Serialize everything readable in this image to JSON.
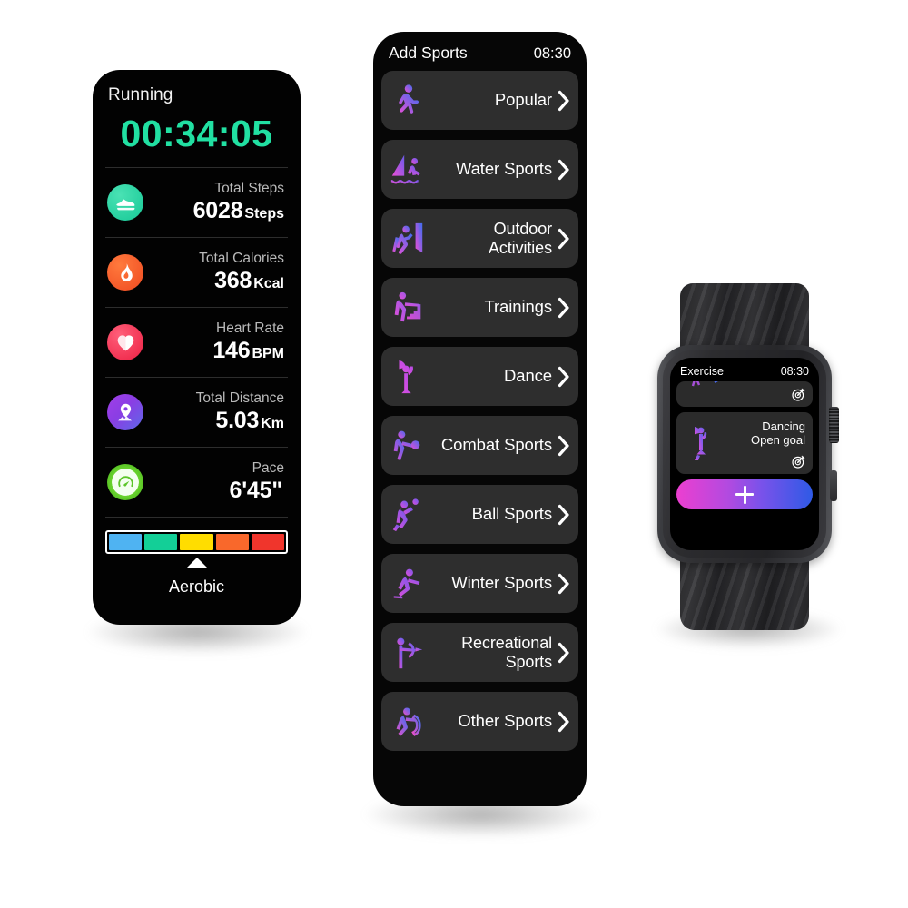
{
  "running_panel": {
    "title": "Running",
    "timer": "00:34:05",
    "timer_color": "#21e0a2",
    "metrics": [
      {
        "icon": "shoe-icon",
        "label": "Total Steps",
        "value": "6028",
        "unit": "Steps",
        "color": "#25d3a0"
      },
      {
        "icon": "flame-icon",
        "label": "Total Calories",
        "value": "368",
        "unit": "Kcal",
        "color": "#f2552a"
      },
      {
        "icon": "heart-icon",
        "label": "Heart Rate",
        "value": "146",
        "unit": "BPM",
        "color": "#f22f4e"
      },
      {
        "icon": "location-icon",
        "label": "Total Distance",
        "value": "5.03",
        "unit": "Km",
        "color": "#8b3fe0"
      },
      {
        "icon": "speedometer-icon",
        "label": "Pace",
        "value": "6'45\"",
        "unit": "",
        "color": "#55c92c"
      }
    ],
    "zone_bar": {
      "segments": [
        "#4fb3f2",
        "#13cf97",
        "#ffdd00",
        "#f9682b",
        "#f0352c"
      ],
      "active_index": 2,
      "zone_name": "Aerobic"
    }
  },
  "sports_panel": {
    "title": "Add Sports",
    "time": "08:30",
    "chevron_icon": "chevron-right-icon",
    "items": [
      {
        "label": "Popular",
        "icon": "runner-icon"
      },
      {
        "label": "Water Sports",
        "icon": "windsurf-icon"
      },
      {
        "label": "Outdoor Activities",
        "icon": "climbing-icon"
      },
      {
        "label": "Trainings",
        "icon": "stepper-icon"
      },
      {
        "label": "Dance",
        "icon": "dancer-icon"
      },
      {
        "label": "Combat Sports",
        "icon": "boxer-icon"
      },
      {
        "label": "Ball Sports",
        "icon": "volleyball-icon"
      },
      {
        "label": "Winter Sports",
        "icon": "skater-icon"
      },
      {
        "label": "Recreational Sports",
        "icon": "archer-icon"
      },
      {
        "label": "Other Sports",
        "icon": "rope-jump-icon"
      }
    ]
  },
  "watch": {
    "screen_title": "Exercise",
    "time": "08:30",
    "card": {
      "name": "Dancing",
      "goal": "Open goal",
      "goal_icon": "target-goal-icon",
      "figure_icon": "dancer-icon"
    },
    "add_button": {
      "icon": "plus-icon",
      "gradient_from": "#ec3fd0",
      "gradient_to": "#2f5ae6"
    }
  }
}
